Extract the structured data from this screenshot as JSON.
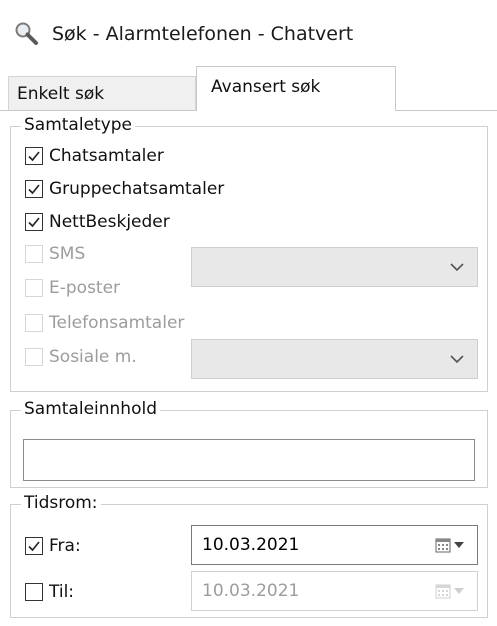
{
  "window": {
    "title": "Søk - Alarmtelefonen - Chatvert",
    "icon": "search-icon"
  },
  "tabs": [
    {
      "label": "Enkelt søk",
      "active": false
    },
    {
      "label": "Avansert søk",
      "active": true
    }
  ],
  "samtaletype": {
    "legend": "Samtaletype",
    "items": [
      {
        "label": "Chatsamtaler",
        "checked": true,
        "enabled": true
      },
      {
        "label": "Gruppechatsamtaler",
        "checked": true,
        "enabled": true
      },
      {
        "label": "NettBeskjeder",
        "checked": true,
        "enabled": true
      },
      {
        "label": "SMS",
        "checked": false,
        "enabled": false
      },
      {
        "label": "E-poster",
        "checked": false,
        "enabled": false
      },
      {
        "label": "Telefonsamtaler",
        "checked": false,
        "enabled": false
      },
      {
        "label": "Sosiale m.",
        "checked": false,
        "enabled": false
      }
    ],
    "sms_combo_value": "",
    "sosiale_combo_value": ""
  },
  "samtaleinnhold": {
    "legend": "Samtaleinnhold",
    "value": ""
  },
  "tidsrom": {
    "legend": "Tidsrom:",
    "fra": {
      "label": "Fra:",
      "checked": true,
      "date": "10.03.2021",
      "enabled": true
    },
    "til": {
      "label": "Til:",
      "checked": false,
      "date": "10.03.2021",
      "enabled": false
    }
  },
  "colors": {
    "disabled_text": "#9c9c9c",
    "combo_disabled_bg": "#e8e8e8"
  }
}
